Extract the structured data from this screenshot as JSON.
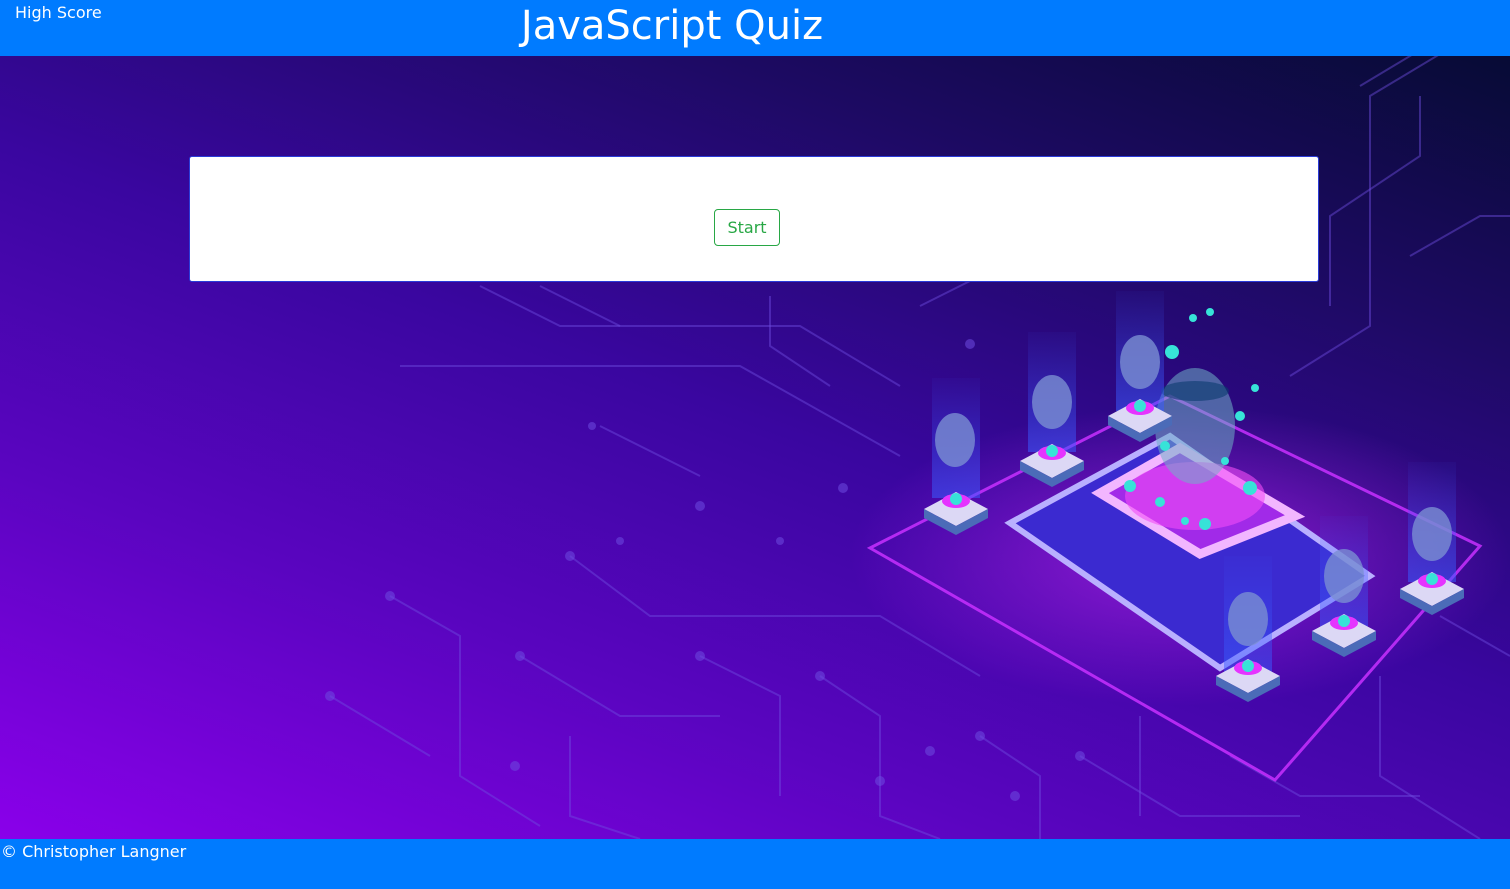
{
  "header": {
    "high_score_label": "High Score",
    "title": "JavaScript Quiz"
  },
  "quiz": {
    "start_label": "Start"
  },
  "footer": {
    "copyright": "© Christopher Langner"
  },
  "colors": {
    "header_bg": "#007bff",
    "footer_bg": "#007bff",
    "start_button_accent": "#28a745",
    "card_bg": "#ffffff"
  },
  "background": {
    "image": "isometric-circuit-server-illustration"
  }
}
